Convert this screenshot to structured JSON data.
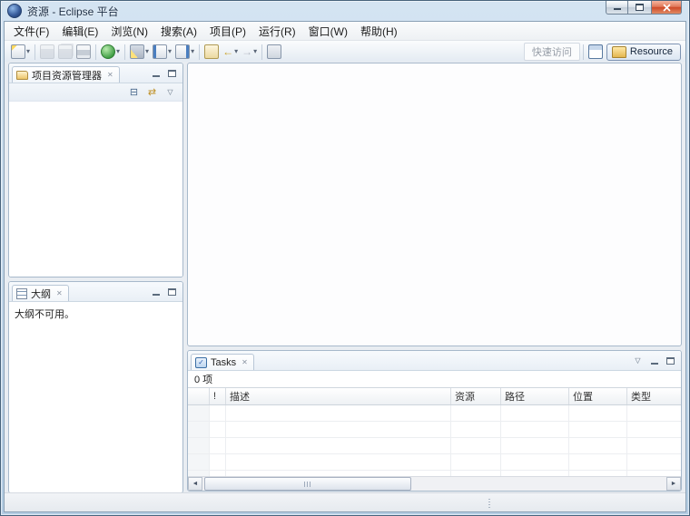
{
  "window": {
    "title": "资源 - Eclipse 平台"
  },
  "menu_bar": {
    "items": [
      {
        "label": "文件(F)"
      },
      {
        "label": "编辑(E)"
      },
      {
        "label": "浏览(N)"
      },
      {
        "label": "搜索(A)"
      },
      {
        "label": "项目(P)"
      },
      {
        "label": "运行(R)"
      },
      {
        "label": "窗口(W)"
      },
      {
        "label": "帮助(H)"
      }
    ]
  },
  "toolbar": {
    "quick_access_label": "快速访问",
    "perspective": {
      "resource_label": "Resource"
    }
  },
  "project_explorer": {
    "tab_title": "项目资源管理器"
  },
  "outline": {
    "tab_title": "大纲",
    "empty_message": "大纲不可用。"
  },
  "tasks": {
    "tab_title": "Tasks",
    "items_count": "0 项",
    "columns": [
      "",
      "!",
      "描述",
      "资源",
      "路径",
      "位置",
      "类型"
    ]
  },
  "icons": {
    "dropdown": "▾",
    "view_menu": "▽",
    "close_tab": "✕",
    "collapse_all": "⊟",
    "link_with_editor": "⇄",
    "back_arrow": "←",
    "forward_arrow": "→",
    "scroll_left": "◄",
    "scroll_right": "►",
    "tasks_check": "✓"
  }
}
